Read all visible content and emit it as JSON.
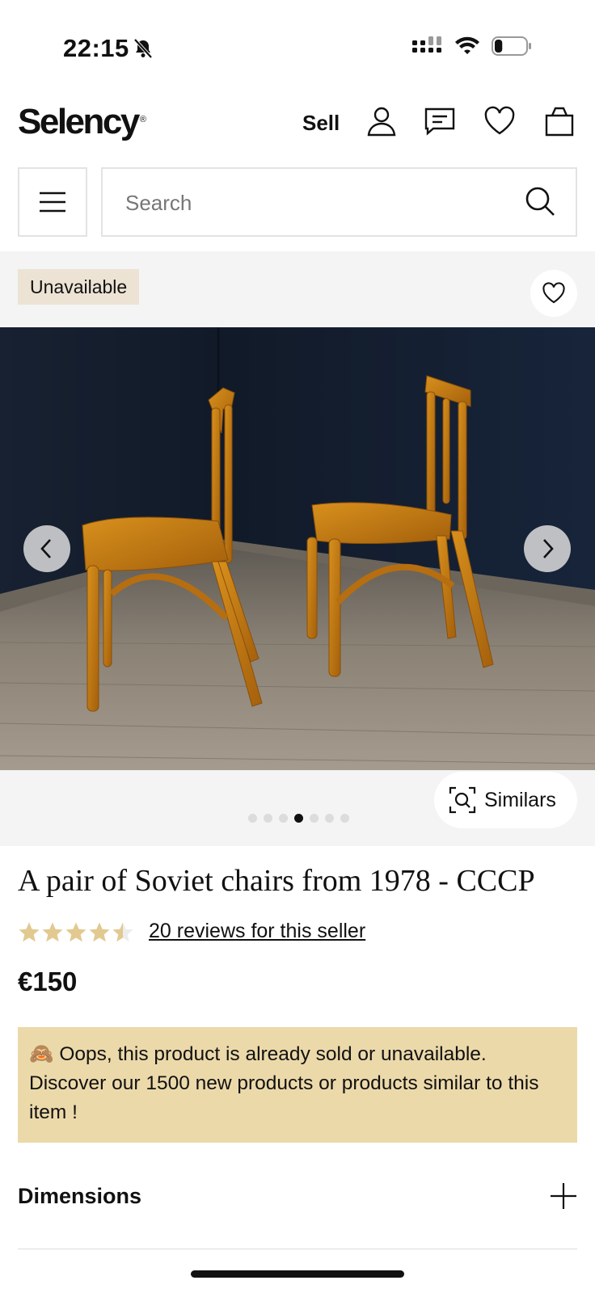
{
  "status_bar": {
    "time": "22:15",
    "battery_level": 0.25
  },
  "header": {
    "logo": "Selency",
    "logo_mark": "®",
    "sell_label": "Sell",
    "icons": [
      "user-icon",
      "chat-icon",
      "heart-icon",
      "bag-icon"
    ]
  },
  "search": {
    "placeholder": "Search"
  },
  "product": {
    "badge": "Unavailable",
    "title": "A pair of Soviet chairs from 1978 - CCCP",
    "rating": 4.5,
    "rating_max": 5,
    "reviews_label": "20 reviews for this seller",
    "price": "€150",
    "similars_label": "Similars",
    "gallery": {
      "total_images": 7,
      "current_index": 3
    }
  },
  "notice": {
    "emoji": "🙈",
    "text": "Oops, this product is already sold or unavailable. Discover our 1500 new products or products similar to this item !"
  },
  "accordion": {
    "dimensions_label": "Dimensions"
  },
  "colors": {
    "accent_star": "#e2c98f",
    "notice_bg": "#ecd9aa",
    "badge_bg": "#ece3d4"
  }
}
